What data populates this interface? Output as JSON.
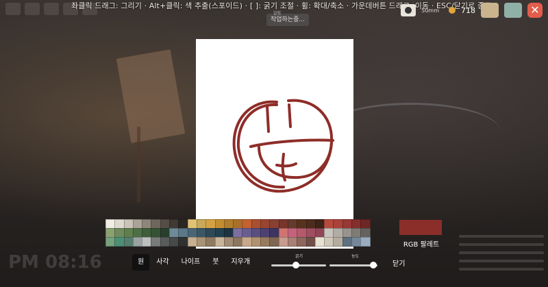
{
  "hint_text": "좌클릭 드래그: 그리기 · Alt+클릭: 색 추출(스포이드) · [ ]: 굵기 조절 · 휠: 확대/축소 · 가운데버튼 드래그: 이동 · ESC/닫기로 종료",
  "tooltip": {
    "title": "알림",
    "text": "작업하는중..."
  },
  "hud": {
    "lens_label": "50mm",
    "coins": "718"
  },
  "clock": "PM 08:16",
  "current_color": "#8b2e2a",
  "rgb_palette_label": "RGB 팔레트",
  "tools": [
    {
      "label": "원",
      "active": true
    },
    {
      "label": "사각",
      "active": false
    },
    {
      "label": "나이프",
      "active": false
    },
    {
      "label": "붓",
      "active": false
    },
    {
      "label": "지우개",
      "active": false
    }
  ],
  "thickness_label": "굵기",
  "opacity_label": "농도",
  "thickness_value": 0.45,
  "opacity_value": 0.92,
  "close_label": "닫기",
  "palette": [
    "#f1ede3",
    "#dedad0",
    "#c9c3b8",
    "#aba397",
    "#8e867a",
    "#6e675d",
    "#544e46",
    "#3f3a34",
    "#2a2622",
    "#e0c274",
    "#c8a85a",
    "#d4a244",
    "#c28e31",
    "#b07d2e",
    "#a9702a",
    "#c2622f",
    "#aa4f30",
    "#984532",
    "#874032",
    "#77352c",
    "#663a2d",
    "#56321f",
    "#4d2b1d",
    "#3e2418",
    "#b74a3e",
    "#a9423a",
    "#973834",
    "#842f2c",
    "#6d2724",
    "#8aa170",
    "#6f8a5c",
    "#5f7f4e",
    "#4e6e45",
    "#3f5e3a",
    "#355234",
    "#283f2b",
    "#6d8a98",
    "#5b7887",
    "#4a6674",
    "#3b5665",
    "#2f4856",
    "#234050",
    "#1c3341",
    "#7c6fa0",
    "#6a5d90",
    "#5a4e80",
    "#4c4171",
    "#3d3461",
    "#d07470",
    "#c6637c",
    "#b35b6c",
    "#a04f60",
    "#8f4657",
    "#c9c4bd",
    "#b1aca5",
    "#98948d",
    "#7f7b75",
    "#66635f",
    "#77a07c",
    "#4d8f74",
    "#567e6e",
    "#9aa2a2",
    "#bcc1c0",
    "#787b7a",
    "#5a5c5c",
    "#484a4a",
    "#2f3131",
    "#c6b091",
    "#a99376",
    "#8e7b62",
    "#c9b69a",
    "#a38c74",
    "#8a7661",
    "#c7a88a",
    "#b09270",
    "#987a5f",
    "#7e6650",
    "#c79b8e",
    "#aa7f74",
    "#8d665d",
    "#6f4f48",
    "#e7e1d2",
    "#cfc8b9",
    "#b4ad9e",
    "#5f7080",
    "#758798",
    "#9aadc0"
  ]
}
